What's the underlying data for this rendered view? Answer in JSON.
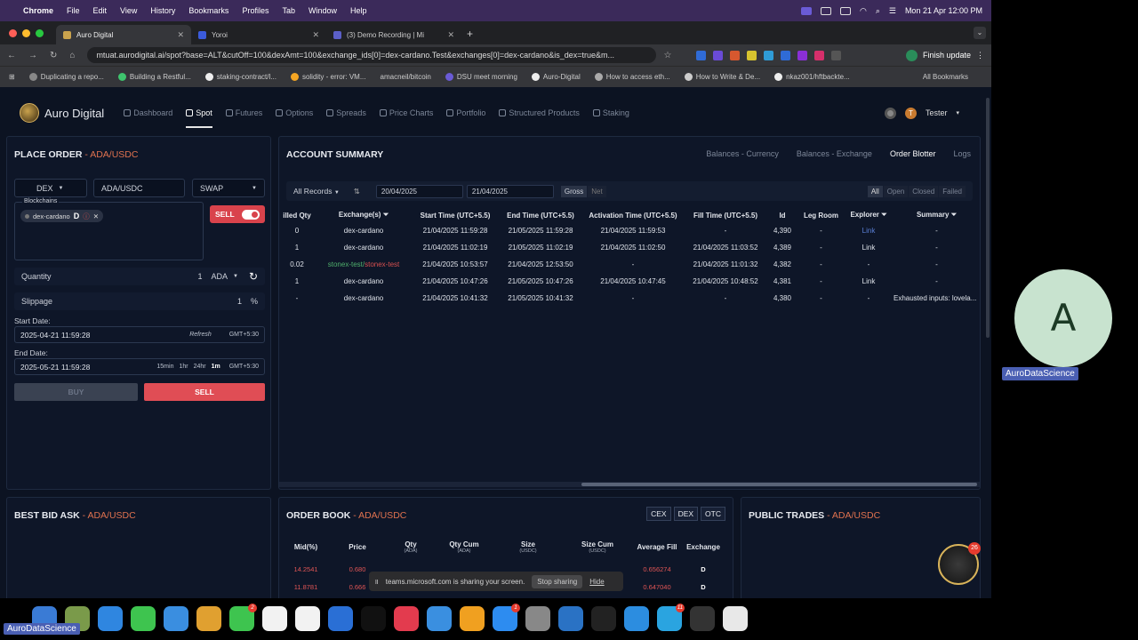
{
  "menubar": {
    "app": "Chrome",
    "items": [
      "File",
      "Edit",
      "View",
      "History",
      "Bookmarks",
      "Profiles",
      "Tab",
      "Window",
      "Help"
    ],
    "clock": "Mon 21 Apr  12:00 PM"
  },
  "browser": {
    "tabs": [
      {
        "title": "Auro Digital",
        "active": true
      },
      {
        "title": "Yoroi",
        "active": false
      },
      {
        "title": "(3) Demo Recording | Mi",
        "active": false
      }
    ],
    "url": "mtuat.aurodigital.ai/spot?base=ALT&cutOff=100&dexAmt=100&exchange_ids[0]=dex-cardano.Test&exchanges[0]=dex-cardano&is_dex=true&m...",
    "finish_update": "Finish update",
    "bookmarks": [
      "Duplicating a repo...",
      "Building a Restful...",
      "staking-contract/l...",
      "solidity - error: VM...",
      "amacneil/bitcoin",
      "DSU meet morning",
      "Auro-Digital",
      "How to access eth...",
      "How to Write & De...",
      "nkaz001/hftbackte..."
    ],
    "all_bookmarks": "All Bookmarks"
  },
  "app": {
    "brand": "Auro Digital",
    "nav": [
      {
        "label": "Dashboard",
        "active": false
      },
      {
        "label": "Spot",
        "active": true
      },
      {
        "label": "Futures",
        "active": false
      },
      {
        "label": "Options",
        "active": false
      },
      {
        "label": "Spreads",
        "active": false
      },
      {
        "label": "Price Charts",
        "active": false
      },
      {
        "label": "Portfolio",
        "active": false
      },
      {
        "label": "Structured Products",
        "active": false
      },
      {
        "label": "Staking",
        "active": false
      }
    ],
    "user": "Tester",
    "user_initial": "T"
  },
  "place_order": {
    "title": "PLACE ORDER",
    "pair": " - ADA/USDC",
    "venue": "DEX",
    "pair_select": "ADA/USDC",
    "order_type": "SWAP",
    "blockchains_label": "Blockchains",
    "chip": "dex-cardano",
    "chip_badge": "D",
    "side_toggle": "SELL",
    "quantity_label": "Quantity",
    "quantity": "1",
    "quantity_unit": "ADA",
    "slippage_label": "Slippage",
    "slippage": "1",
    "slippage_unit": "%",
    "start_label": "Start Date:",
    "start_value": "2025-04-21 11:59:28",
    "refresh": "Refresh",
    "tz1": "GMT+5:30",
    "end_label": "End Date:",
    "end_value": "2025-05-21 11:59:28",
    "presets": [
      "15min",
      "1hr",
      "24hr",
      "1m"
    ],
    "tz2": "GMT+5:30",
    "buy": "BUY",
    "sell": "SELL"
  },
  "account_summary": {
    "title": "ACCOUNT SUMMARY",
    "tabs": [
      {
        "label": "Balances - Currency",
        "active": false
      },
      {
        "label": "Balances - Exchange",
        "active": false
      },
      {
        "label": "Order Blotter",
        "active": true
      },
      {
        "label": "Logs",
        "active": false
      }
    ],
    "records": "All Records",
    "from": "20/04/2025",
    "to": "21/04/2025",
    "gross": "Gross",
    "net": "Net",
    "status_filters": [
      "All",
      "Open",
      "Closed",
      "Failed"
    ],
    "columns": [
      "illed Qty",
      "Exchange(s)",
      "Start Time (UTC+5.5)",
      "End Time (UTC+5.5)",
      "Activation Time (UTC+5.5)",
      "Fill Time (UTC+5.5)",
      "Id",
      "Leg Room",
      "Explorer",
      "Summary"
    ],
    "rows": [
      {
        "qty": "0",
        "ex": "dex-cardano",
        "start": "21/04/2025 11:59:28",
        "end": "21/05/2025 11:59:28",
        "act": "21/04/2025 11:59:53",
        "fill": "-",
        "id": "4,390",
        "leg": "-",
        "exp": "Link",
        "sum": "-"
      },
      {
        "qty": "1",
        "ex": "dex-cardano",
        "start": "21/04/2025 11:02:19",
        "end": "21/05/2025 11:02:19",
        "act": "21/04/2025 11:02:50",
        "fill": "21/04/2025 11:03:52",
        "id": "4,389",
        "leg": "-",
        "exp": "Link",
        "sum": "-"
      },
      {
        "qty": "0.02",
        "ex_g": "stonex-test/",
        "ex_r": "stonex-test",
        "start": "21/04/2025 10:53:57",
        "end": "21/04/2025 12:53:50",
        "act": "-",
        "fill": "21/04/2025 11:01:32",
        "id": "4,382",
        "leg": "-",
        "exp": "-",
        "sum": "-"
      },
      {
        "qty": "1",
        "ex": "dex-cardano",
        "start": "21/04/2025 10:47:26",
        "end": "21/05/2025 10:47:26",
        "act": "21/04/2025 10:47:45",
        "fill": "21/04/2025 10:48:52",
        "id": "4,381",
        "leg": "-",
        "exp": "Link",
        "sum": "-"
      },
      {
        "qty": "-",
        "ex": "dex-cardano",
        "start": "21/04/2025 10:41:32",
        "end": "21/05/2025 10:41:32",
        "act": "-",
        "fill": "-",
        "id": "4,380",
        "leg": "-",
        "exp": "-",
        "sum": "Exhausted inputs: lovela..."
      }
    ]
  },
  "best_bid_ask": {
    "title": "BEST BID ASK",
    "pair": " - ADA/USDC"
  },
  "order_book": {
    "title": "ORDER BOOK",
    "pair": " - ADA/USDC",
    "filters": [
      "CEX",
      "DEX",
      "OTC"
    ],
    "headers": [
      {
        "h": "Mid(%)",
        "s": ""
      },
      {
        "h": "Price",
        "s": ""
      },
      {
        "h": "Qty",
        "s": "(ADA)"
      },
      {
        "h": "Qty Cum",
        "s": "(ADA)"
      },
      {
        "h": "Size",
        "s": "(USDC)"
      },
      {
        "h": "Size Cum",
        "s": "(USDC)"
      },
      {
        "h": "Average Fill",
        "s": ""
      },
      {
        "h": "Exchange",
        "s": ""
      }
    ],
    "rows": [
      {
        "mid": "14.2541",
        "price": "0.680",
        "avg": "0.656274",
        "ex": "D"
      },
      {
        "mid": "11.8781",
        "price": "0.666",
        "avg": "0.647040",
        "ex": "D"
      }
    ]
  },
  "public_trades": {
    "title": "PUBLIC TRADES",
    "pair": " - ADA/USDC"
  },
  "share_bar": {
    "text": "teams.microsoft.com is sharing your screen.",
    "stop": "Stop sharing",
    "hide": "Hide"
  },
  "participant": {
    "initial": "A",
    "name": "AuroDataScience"
  },
  "presenter_label": "AuroDataScience",
  "globe_badge": "26",
  "dock": [
    {
      "c": "#3a7bd5",
      "b": ""
    },
    {
      "c": "#7a9a4a",
      "b": ""
    },
    {
      "c": "#2f86e0",
      "b": ""
    },
    {
      "c": "#3ec44f",
      "b": ""
    },
    {
      "c": "#3a8ee0",
      "b": ""
    },
    {
      "c": "#e0a030",
      "b": ""
    },
    {
      "c": "#3ec44f",
      "b": "2"
    },
    {
      "c": "#f2f2f2",
      "b": ""
    },
    {
      "c": "#f2f2f2",
      "b": ""
    },
    {
      "c": "#2a6fd5",
      "b": ""
    },
    {
      "c": "#111111",
      "b": ""
    },
    {
      "c": "#e33b4e",
      "b": ""
    },
    {
      "c": "#3a8fe0",
      "b": ""
    },
    {
      "c": "#f0a020",
      "b": ""
    },
    {
      "c": "#2d8cf0",
      "b": "1"
    },
    {
      "c": "#888888",
      "b": ""
    },
    {
      "c": "#2a72c4",
      "b": ""
    },
    {
      "c": "#222222",
      "b": ""
    },
    {
      "c": "#2c8de0",
      "b": ""
    },
    {
      "c": "#2aa4e0",
      "b": "11"
    },
    {
      "c": "#333333",
      "b": ""
    },
    {
      "c": "#e8e8e8",
      "b": ""
    }
  ]
}
